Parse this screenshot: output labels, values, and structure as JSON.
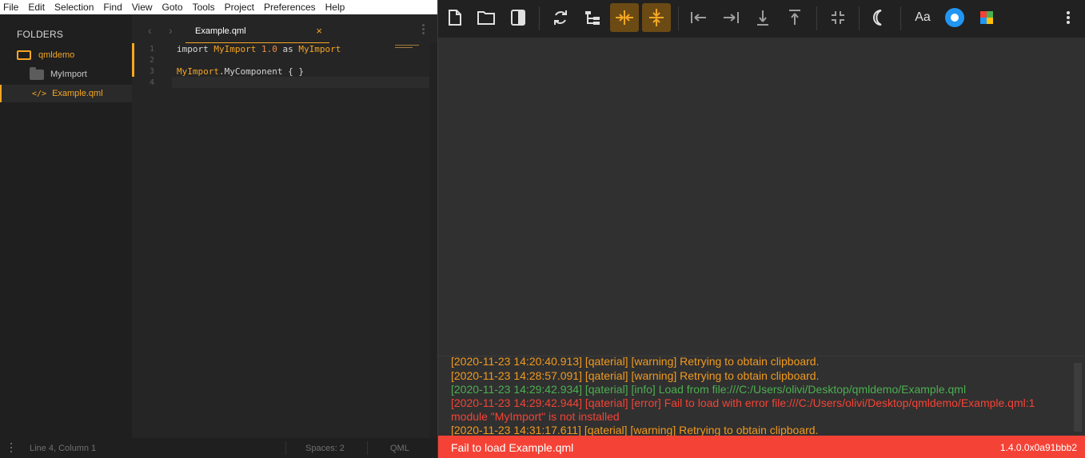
{
  "menubar": {
    "items": [
      "File",
      "Edit",
      "Selection",
      "Find",
      "View",
      "Goto",
      "Tools",
      "Project",
      "Preferences",
      "Help"
    ]
  },
  "sidebar": {
    "title": "FOLDERS",
    "root": "qmldemo",
    "folder": "MyImport",
    "file": "Example.qml",
    "file_glyph": "</>"
  },
  "tabs": {
    "active_label": "Example.qml",
    "close_glyph": "×",
    "back_glyph": "‹",
    "forward_glyph": "›"
  },
  "code": {
    "line_numbers": [
      "1",
      "2",
      "3",
      "4"
    ],
    "line1": {
      "kw": "import",
      "ty": "MyImport",
      "num": "1.0",
      "as": "as",
      "alias": "MyImport"
    },
    "line3": {
      "ty": "MyImport",
      "dot_member": ".MyComponent",
      "braces": " { }"
    }
  },
  "statusbar": {
    "position": "Line 4, Column 1",
    "spaces": "Spaces: 2",
    "syntax": "QML"
  },
  "toolbar": {
    "text_button": "Aa",
    "icons": [
      "new-file-icon",
      "open-folder-icon",
      "sidebar-toggle-icon",
      "reload-icon",
      "tree-view-icon",
      "center-horizontal-icon",
      "center-vertical-icon",
      "align-left-icon",
      "align-right-icon",
      "align-bottom-icon",
      "align-top-icon",
      "shrink-icon",
      "dark-theme-icon",
      "font-icon",
      "material-theme-icon",
      "palette-icon",
      "more-menu-icon"
    ],
    "accent": "#f5a623",
    "active_bg": "#6b4a14"
  },
  "log": {
    "lines": [
      {
        "level": "warning",
        "text": "[2020-11-23 14:20:40.913] [qaterial] [warning] Retrying to obtain clipboard."
      },
      {
        "level": "warning",
        "text": "[2020-11-23 14:28:57.091] [qaterial] [warning] Retrying to obtain clipboard."
      },
      {
        "level": "info",
        "text": "[2020-11-23 14:29:42.934] [qaterial] [info] Load from file:///C:/Users/olivi/Desktop/qmldemo/Example.qml"
      },
      {
        "level": "error",
        "text": "[2020-11-23 14:29:42.944] [qaterial] [error] Fail to load with error file:///C:/Users/olivi/Desktop/qmldemo/Example.qml:1"
      },
      {
        "level": "error",
        "text": "module \"MyImport\" is not installed"
      },
      {
        "level": "warning",
        "text": "[2020-11-23 14:31:17.611] [qaterial] [warning] Retrying to obtain clipboard."
      }
    ],
    "colors": {
      "warning": "#f29a1e",
      "info": "#4caf50",
      "error": "#f44336"
    }
  },
  "errorbar": {
    "message": "Fail to load Example.qml",
    "version": "1.4.0.0x0a91bbb2",
    "color": "#f44336"
  }
}
